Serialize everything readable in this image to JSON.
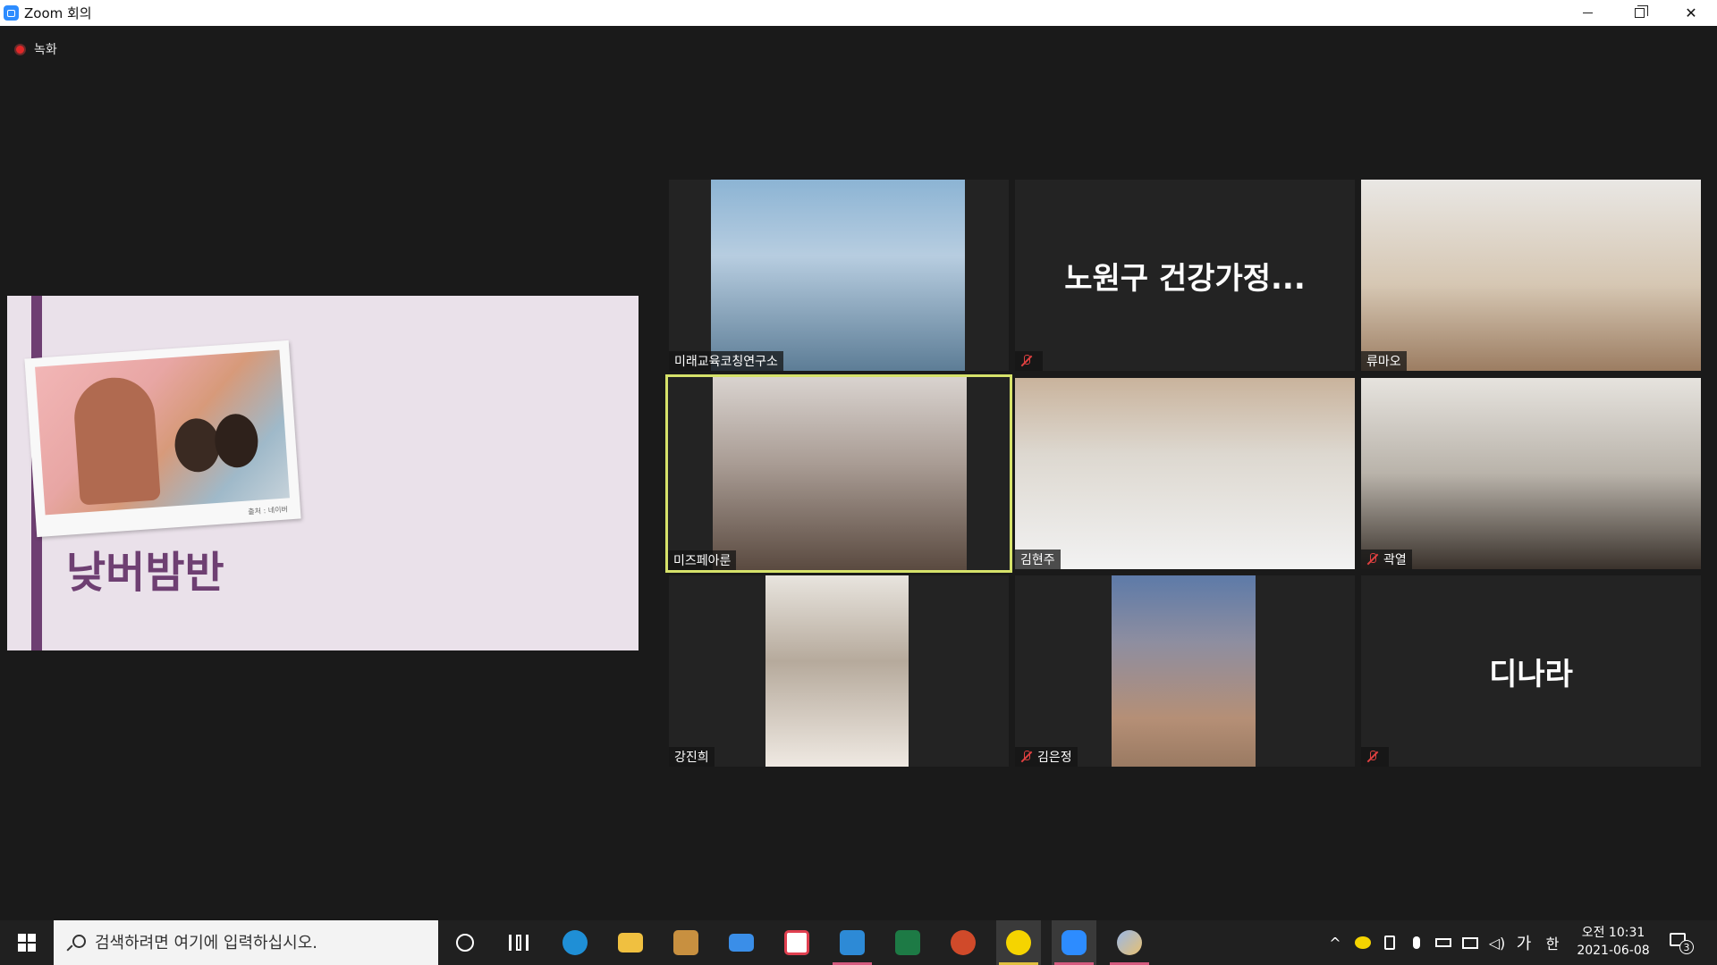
{
  "window": {
    "title": "Zoom 회의"
  },
  "recording": {
    "label": "녹화"
  },
  "slide": {
    "title": "낮버밤반",
    "photo_caption": "출처 : 네이버"
  },
  "participants": [
    {
      "name": "미래교육코칭연구소",
      "muted": false,
      "video": true,
      "bg": "#6f9cc0"
    },
    {
      "name": "",
      "display_name": "노원구 건강가정...",
      "muted": true,
      "video": false
    },
    {
      "name": "류마오",
      "muted": false,
      "video": true,
      "bg": "#c9b9a5"
    },
    {
      "name": "미즈페아룬",
      "muted": false,
      "video": true,
      "active": true,
      "bg": "#b7aca6"
    },
    {
      "name": "김현주",
      "muted": false,
      "video": true,
      "bg": "#c7c1b7"
    },
    {
      "name": "곽열",
      "muted": true,
      "video": true,
      "bg": "#bfb8ae"
    },
    {
      "name": "강진희",
      "muted": false,
      "video": true,
      "bg": "#c9c2b8"
    },
    {
      "name": "김은정",
      "muted": true,
      "video": true,
      "bg": "#7f8aa0"
    },
    {
      "name": "",
      "display_name": "디나라",
      "muted": true,
      "video": false
    }
  ],
  "taskbar": {
    "search_placeholder": "검색하려면 여기에 입력하십시오.",
    "apps": [
      {
        "name": "cortana-icon"
      },
      {
        "name": "task-view-icon"
      },
      {
        "name": "edge-icon",
        "color": "#1f8fd6"
      },
      {
        "name": "file-explorer-icon",
        "color": "#f0c040"
      },
      {
        "name": "store-icon",
        "color": "#d0a040"
      },
      {
        "name": "mail-icon",
        "color": "#3a8ee8"
      },
      {
        "name": "sync-app-icon",
        "color": "#e04050"
      },
      {
        "name": "hangul-icon",
        "color": "#2d8ad6"
      },
      {
        "name": "excel-icon",
        "color": "#1d7a45"
      },
      {
        "name": "powerpoint-icon",
        "color": "#d04a2a"
      },
      {
        "name": "kakaotalk-icon",
        "color": "#f5d400"
      },
      {
        "name": "zoom-icon",
        "color": "#2d8cff"
      },
      {
        "name": "paint-icon",
        "color": "#9ab8e8"
      }
    ],
    "tray": {
      "ime_mode": "가",
      "ime_lang": "한",
      "clock_time": "오전 10:31",
      "clock_date": "2021-06-08",
      "notification_count": "3"
    }
  }
}
